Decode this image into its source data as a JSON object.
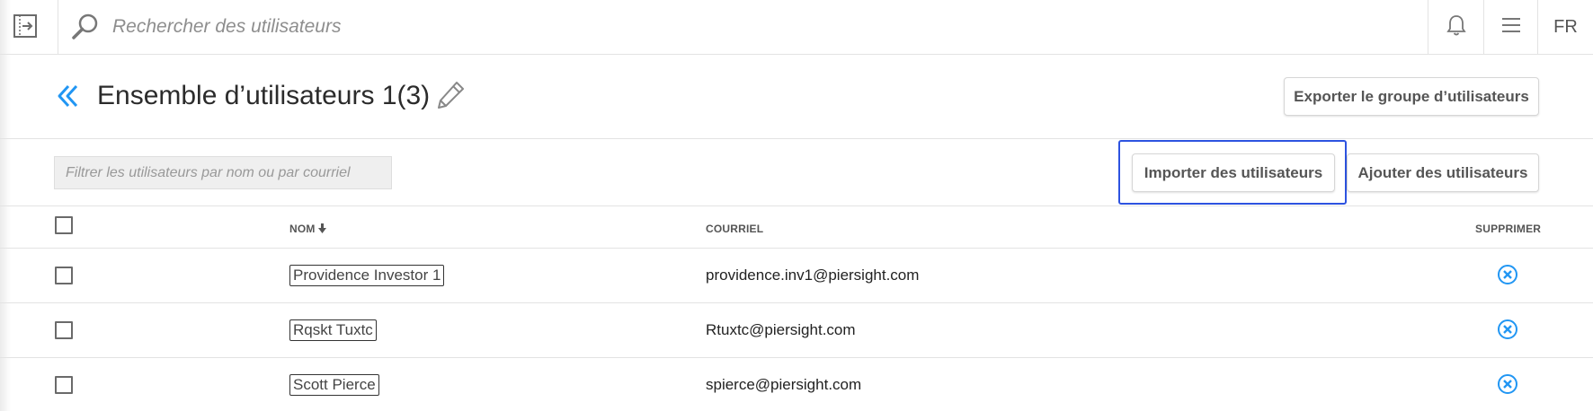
{
  "topbar": {
    "search_placeholder": "Rechercher des utilisateurs",
    "language": "FR"
  },
  "header": {
    "title": "Ensemble d’utilisateurs 1(3)",
    "export_label": "Exporter le groupe d’utilisateurs"
  },
  "toolbar": {
    "filter_placeholder": "Filtrer les utilisateurs par nom ou par courriel",
    "import_label": "Importer des utilisateurs",
    "add_label": "Ajouter des utilisateurs"
  },
  "table": {
    "headers": {
      "name": "NOM",
      "email": "COURRIEL",
      "delete": "SUPPRIMER"
    },
    "rows": [
      {
        "name": "Providence Investor 1",
        "email": "providence.inv1@piersight.com"
      },
      {
        "name": "Rqskt Tuxtc",
        "email": "Rtuxtc@piersight.com"
      },
      {
        "name": "Scott Pierce",
        "email": "spierce@piersight.com"
      }
    ]
  },
  "colors": {
    "accent": "#2196f3",
    "focus_ring": "#2d53e0"
  },
  "icons": {
    "sidebar_toggle": "sidebar-toggle-icon",
    "search": "search-icon",
    "bell": "bell-icon",
    "menu": "menu-icon",
    "back": "chevron-double-left-icon",
    "edit": "pencil-icon",
    "sort": "sort-down-arrow-icon",
    "delete": "remove-circle-icon"
  }
}
